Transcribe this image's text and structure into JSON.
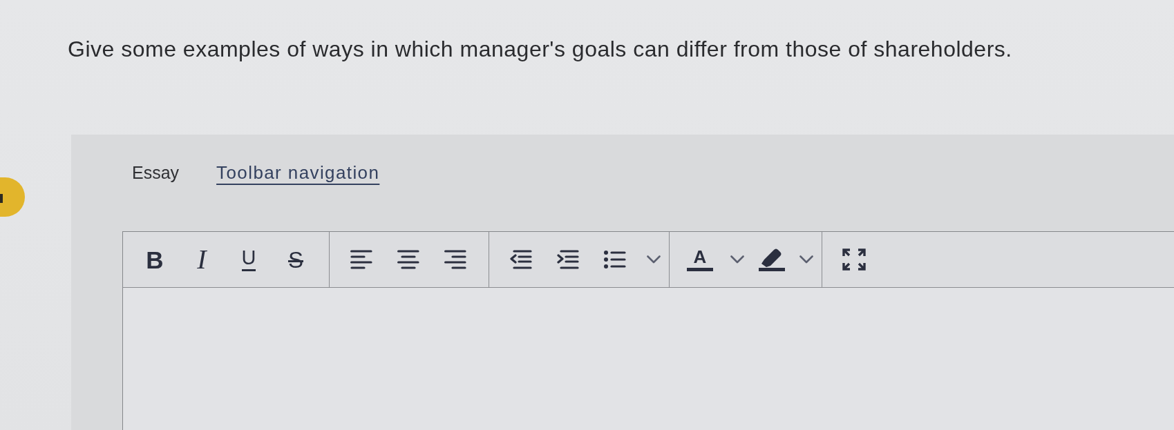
{
  "question": {
    "text": "Give some examples of ways in which manager's goals can differ from those of shareholders."
  },
  "answer_header": {
    "type_label": "Essay",
    "link": "Toolbar navigation"
  },
  "toolbar": {
    "groups": [
      {
        "buttons": [
          {
            "kind": "bold",
            "glyph": "B"
          },
          {
            "kind": "italic",
            "glyph": "I"
          },
          {
            "kind": "underline",
            "glyph": "U"
          },
          {
            "kind": "strikethrough",
            "glyph": "S"
          }
        ]
      },
      {
        "buttons": [
          {
            "kind": "align-left"
          },
          {
            "kind": "align-center"
          },
          {
            "kind": "align-right"
          }
        ]
      },
      {
        "buttons": [
          {
            "kind": "outdent"
          },
          {
            "kind": "indent"
          },
          {
            "kind": "bullet-list"
          },
          {
            "kind": "caret"
          }
        ]
      },
      {
        "buttons": [
          {
            "kind": "font-color",
            "glyph": "A"
          },
          {
            "kind": "caret"
          },
          {
            "kind": "highlight"
          },
          {
            "kind": "caret"
          }
        ]
      },
      {
        "buttons": [
          {
            "kind": "fullscreen"
          }
        ]
      }
    ]
  }
}
